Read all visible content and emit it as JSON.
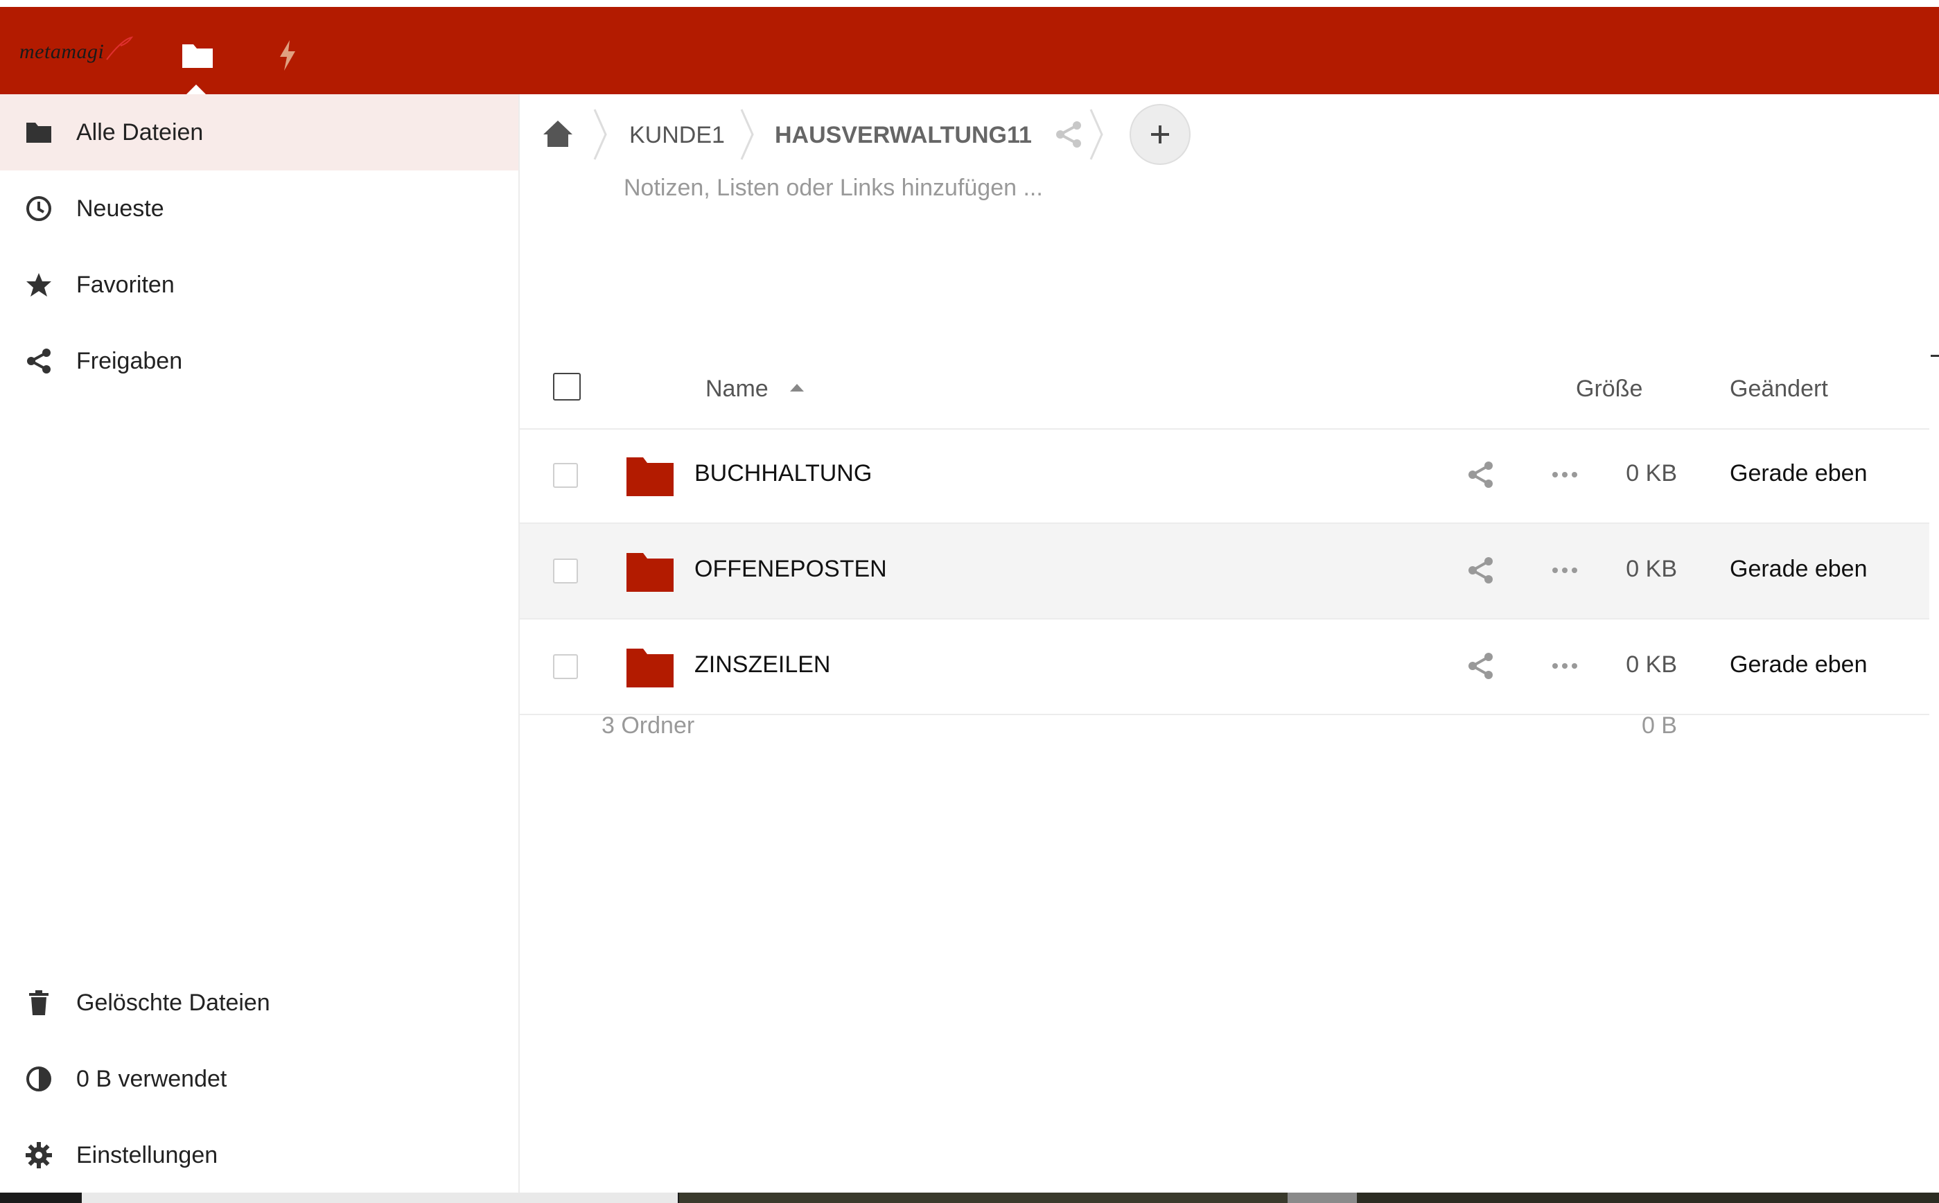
{
  "header": {
    "logo_text": "metamagi",
    "apps": [
      {
        "name": "Dateien",
        "icon": "folder-icon",
        "active": true
      },
      {
        "name": "Aktivität",
        "icon": "lightning-icon",
        "active": false
      }
    ],
    "colors": {
      "brand": "#b31b00",
      "accent_icon": "#e0a080"
    }
  },
  "sidebar": {
    "items": [
      {
        "label": "Alle Dateien",
        "icon": "folder-icon",
        "active": true
      },
      {
        "label": "Neueste",
        "icon": "clock-icon",
        "active": false
      },
      {
        "label": "Favoriten",
        "icon": "star-icon",
        "active": false
      },
      {
        "label": "Freigaben",
        "icon": "share-icon",
        "active": false
      }
    ],
    "bottom_items": [
      {
        "label": "Gelöschte Dateien",
        "icon": "trash-icon"
      },
      {
        "label": "0 B verwendet",
        "icon": "pie-chart-icon"
      },
      {
        "label": "Einstellungen",
        "icon": "gear-icon"
      }
    ]
  },
  "breadcrumb": {
    "home_icon": "home-icon",
    "items": [
      "KUNDE1",
      "HAUSVERWALTUNG11"
    ],
    "share_icon": "share-icon",
    "add_button": "+"
  },
  "notes_placeholder": "Notizen, Listen oder Links hinzufügen ...",
  "table": {
    "columns": {
      "name": "Name",
      "size": "Größe",
      "modified": "Geändert"
    },
    "sort": {
      "column": "name",
      "direction": "ascending"
    },
    "rows": [
      {
        "name": "BUCHHALTUNG",
        "size": "0 KB",
        "modified": "Gerade eben",
        "type": "folder"
      },
      {
        "name": "OFFENEPOSTEN",
        "size": "0 KB",
        "modified": "Gerade eben",
        "type": "folder"
      },
      {
        "name": "ZINSZEILEN",
        "size": "0 KB",
        "modified": "Gerade eben",
        "type": "folder"
      }
    ],
    "summary": {
      "count": "3 Ordner",
      "total": "0 B"
    }
  }
}
